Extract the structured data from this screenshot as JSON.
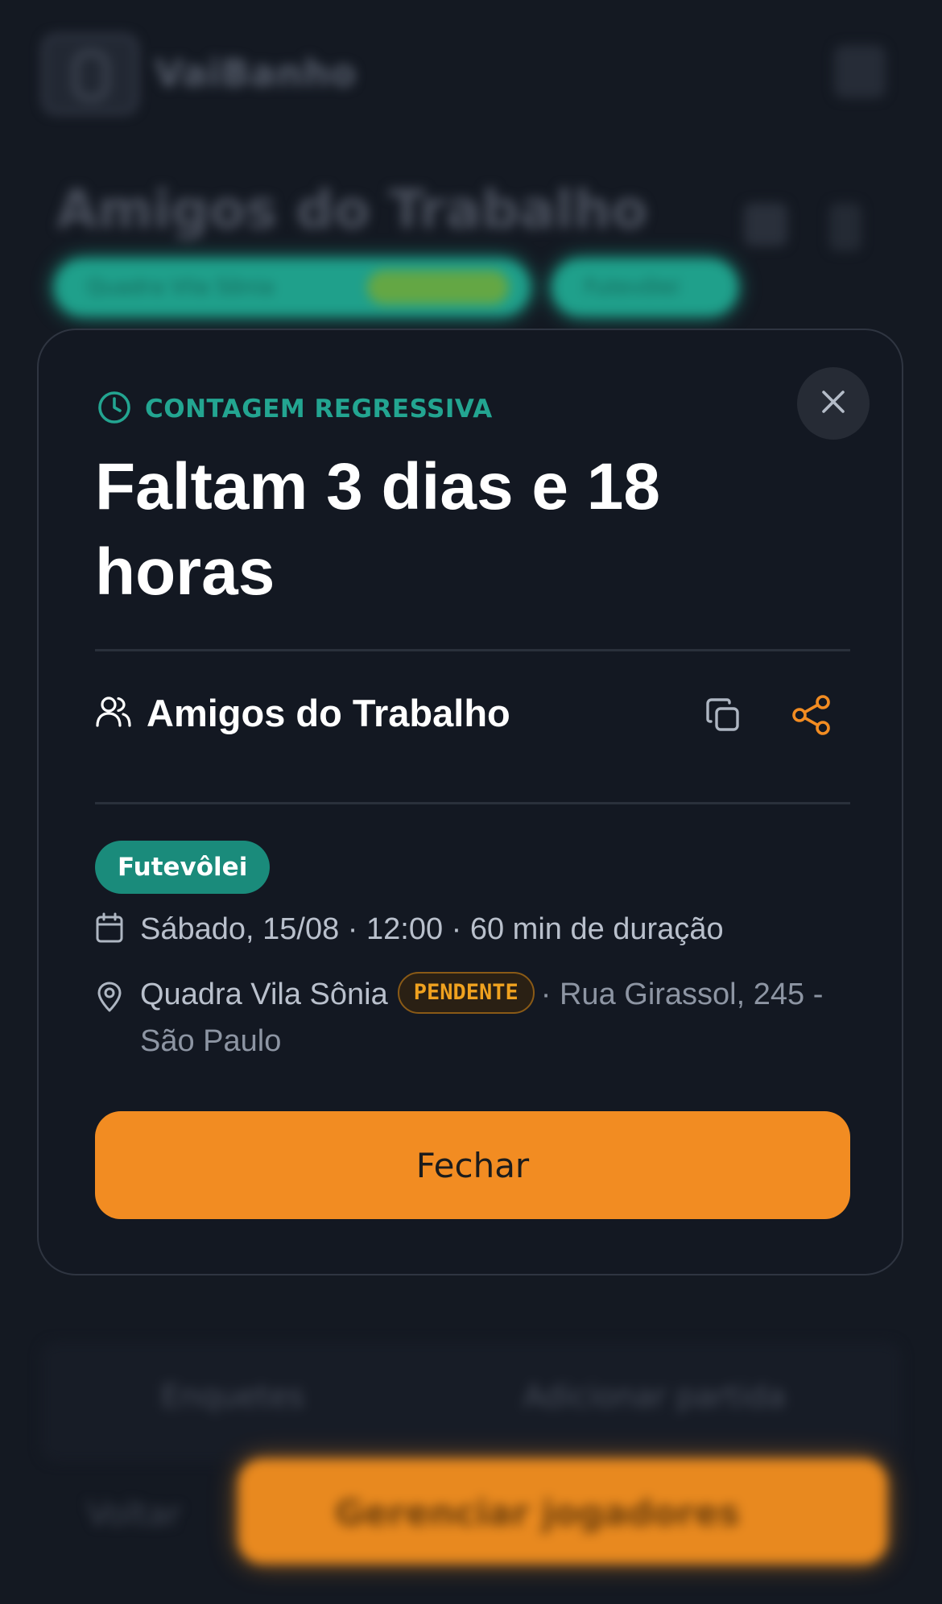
{
  "background": {
    "logo_text": "VaiBanho",
    "group_title": "Amigos do Trabalho",
    "chip_one_label": "Quadra Vila Sônia",
    "chip_two_label": "Futevôlei",
    "link_one": "Enquetes",
    "link_two": "Adicionar partida",
    "back_label": "Voltar",
    "cta_label": "Gerenciar jogadores"
  },
  "modal": {
    "eyebrow": "CONTAGEM REGRESSIVA",
    "headline": "Faltam 3 dias e 18 horas",
    "group_name": "Amigos do Trabalho",
    "sport_badge": "Futevôlei",
    "date_line": "Sábado, 15/08 · 12:00 · 60 min de duração",
    "venue": "Quadra Vila Sônia",
    "venue_status": "PENDENTE",
    "address": "· Rua Girassol, 245 - São Paulo",
    "close_button": "Fechar"
  },
  "icons": {
    "eyebrow": "clock-icon",
    "group": "users-icon",
    "copy": "copy-icon",
    "share": "share-icon",
    "date": "calendar-icon",
    "location": "map-pin-icon",
    "close": "close-icon"
  },
  "colors": {
    "accent_teal": "#23a591",
    "accent_orange": "#f28c22",
    "badge_teal": "#1a8b7b",
    "pending_text": "#f0a21f",
    "background": "#141922",
    "modal_bg": "#131822"
  }
}
